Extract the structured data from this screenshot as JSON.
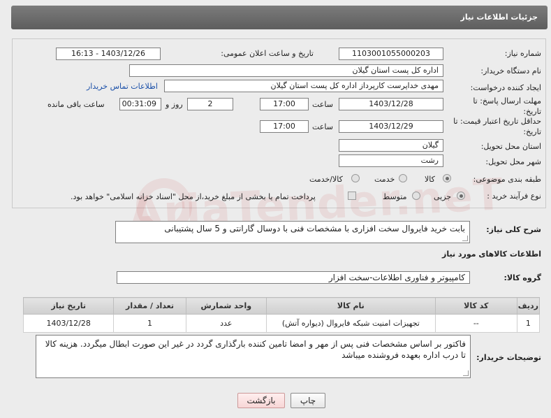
{
  "header": {
    "title": "جزئیات اطلاعات نیاز"
  },
  "form": {
    "need_number_label": "شماره نیاز:",
    "need_number": "1103001055000203",
    "announce_label": "تاریخ و ساعت اعلان عمومی:",
    "announce_value": "1403/12/26 - 16:13",
    "buyer_org_label": "نام دستگاه خریدار:",
    "buyer_org": "اداره کل پست استان گیلان",
    "creator_label": "ایجاد کننده درخواست:",
    "creator": "مهدی  خداپرست  کارپرداز  اداره کل پست استان گیلان",
    "contact_link": "اطلاعات تماس خریدار",
    "deadline_label": "مهلت ارسال پاسخ: تا تاریخ:",
    "deadline_date": "1403/12/28",
    "time_label": "ساعت",
    "deadline_time": "17:00",
    "days_value": "2",
    "days_label": "روز و",
    "remaining_value": "00:31:09",
    "remaining_label": "ساعت باقی مانده",
    "price_valid_label": "حداقل تاریخ اعتبار قیمت: تا تاریخ:",
    "price_valid_date": "1403/12/29",
    "price_valid_time": "17:00",
    "province_label": "استان محل تحویل:",
    "province": "گیلان",
    "city_label": "شهر محل تحویل:",
    "city": "رشت",
    "category_label": "طبقه بندی موضوعی:",
    "category_options": [
      "کالا",
      "خدمت",
      "کالا/خدمت"
    ],
    "category_selected": "کالا",
    "process_label": "نوع فرآیند خرید :",
    "process_options": [
      "جزیی",
      "متوسط"
    ],
    "process_selected": "جزیی",
    "payment_note": "پرداخت تمام یا بخشی از مبلغ خرید،از محل \"اسناد خزانه اسلامی\" خواهد بود."
  },
  "watermark": "AriaTender.neT",
  "description": {
    "label": "شرح کلی نیاز:",
    "text": "بابت خرید فایروال سخت افزاری با مشخصات فنی با دوسال گارانتی و 5 سال پشتیبانی"
  },
  "goods_section": {
    "title": "اطلاعات کالاهای مورد نیاز",
    "group_label": "گروه کالا:",
    "group_value": "کامپیوتر و فناوری اطلاعات-سخت افزار"
  },
  "table": {
    "headers": [
      "ردیف",
      "کد کالا",
      "نام کالا",
      "واحد شمارش",
      "تعداد / مقدار",
      "تاریخ نیاز"
    ],
    "rows": [
      [
        "1",
        "--",
        "تجهیزات امنیت شبکه فایروال (دیواره آتش)",
        "عدد",
        "1",
        "1403/12/28"
      ]
    ]
  },
  "notes": {
    "label": "توضیحات خریدار:",
    "text": "فاکتور بر اساس مشخصات فنی پس از مهر و امضا تامین کننده بارگذاری گردد در غیر این صورت ابطال میگردد. هزینه کالا تا درب اداره بعهده فروشنده میباشد"
  },
  "buttons": {
    "print": "چاپ",
    "back": "بازگشت"
  },
  "colors": {
    "header": "#6b6b6b",
    "link": "#1a4fa8",
    "back_button": "#f7d6d6"
  }
}
